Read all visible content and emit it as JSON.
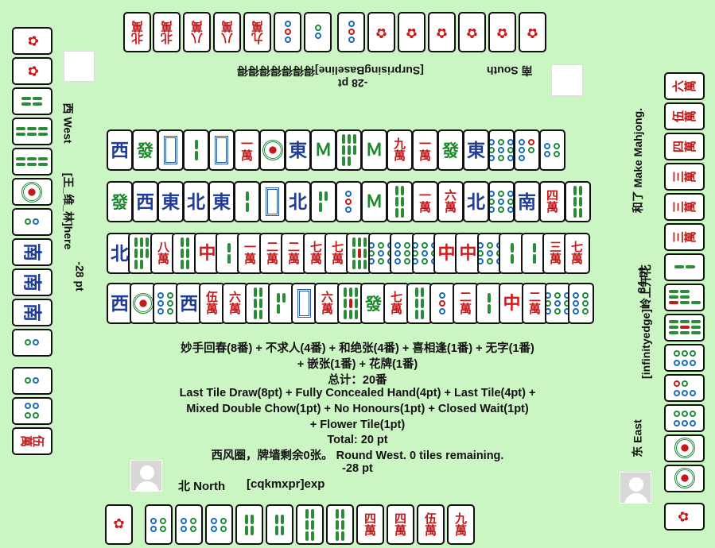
{
  "players": {
    "north": {
      "label": "北 North",
      "name": "[cqkmxpr]exp",
      "score": "-28 pt"
    },
    "east": {
      "label": "东 East",
      "name": "[infinityedge]岭上开花",
      "score": "84 pt",
      "action": "和了 Make Mahjong."
    },
    "south": {
      "label": "南 South",
      "name": "[SurprisingBaseline]得得得得得得得",
      "score": "-28 pt"
    },
    "west": {
      "label": "西 West",
      "name": "[王_维_林]here",
      "score": "-28 pt"
    }
  },
  "result": {
    "fan_cn_line1": "妙手回春(8番) + 不求人(4番) + 和绝张(4番) + 喜相逢(1番) + 无字(1番)",
    "fan_cn_line2": "+ 嵌张(1番) + 花牌(1番)",
    "total_cn": "总计：20番",
    "fan_en_line1": "Last Tile Draw(8pt) + Fully Concealed Hand(4pt) + Last Tile(4pt) +",
    "fan_en_line2": "Mixed Double Chow(1pt) + No Honours(1pt) + Closed Wait(1pt)",
    "fan_en_line3": "+ Flower Tile(1pt)",
    "total_en": "Total: 20 pt",
    "round_info": "西风圈，牌墙剩余0张。 Round West. 0 tiles remaining."
  },
  "tiles": {
    "south_hand": [
      "北萬",
      "北萬",
      "八萬",
      "八萬",
      "九萬",
      "3p",
      "2p",
      "3p",
      "F2s",
      "F2s",
      "F2s",
      "F2s",
      "F冬",
      "F春"
    ],
    "west_hand": [
      "F夏",
      "F竹",
      "4s",
      "6s",
      "6s",
      "1p",
      "2p",
      "南",
      "南",
      "南",
      "2p",
      "2p",
      "4p",
      "伍萬"
    ],
    "north_hand": [
      "F梅",
      "4p",
      "4p",
      "4p",
      "4s",
      "4s",
      "6s",
      "6s",
      "四萬",
      "四萬",
      "伍萬",
      "九萬"
    ],
    "east_hand": [
      "六萬",
      "伍萬",
      "四萬",
      "三萬",
      "三萬",
      "三萬",
      "2s",
      "7s",
      "9s",
      "6p",
      "5p",
      "6p",
      "1p",
      "1p",
      "F菊"
    ],
    "discards_row1": [
      "西",
      "發",
      "白",
      "2s",
      "白",
      "一萬",
      "1p",
      "東",
      "M",
      "8s",
      "M",
      "九萬",
      "一萬",
      "發",
      "東",
      "9p",
      "5p",
      "4p"
    ],
    "discards_row2": [
      "發",
      "西",
      "東",
      "北",
      "東",
      "2s",
      "白",
      "北",
      "3s",
      "3p",
      "M",
      "6s",
      "一萬",
      "六萬",
      "北",
      "9p",
      "南",
      "四萬",
      "6s"
    ],
    "discards_row3": [
      "北",
      "8s",
      "八萬",
      "6s",
      "中",
      "2s",
      "一萬",
      "二萬",
      "二萬",
      "七萬",
      "七萬",
      "9s",
      "9p",
      "6p",
      "9p",
      "中",
      "中",
      "9p",
      "2s",
      "2s",
      "三萬",
      "七萬"
    ],
    "discards_row4": [
      "西",
      "1p",
      "6p",
      "西",
      "伍萬",
      "六萬",
      "6s",
      "3s",
      "白",
      "六萬",
      "9s",
      "發",
      "七萬",
      "6s",
      "3p",
      "二萬",
      "2s",
      "中",
      "二萬",
      "9p",
      "6p"
    ]
  },
  "colors": {
    "background": "#ccf5c4",
    "tile_face": "#ffffff",
    "tile_border": "#111111",
    "character_red": "#c41a1a",
    "bamboo_green": "#2b8c36",
    "dots_blue": "#1a6bbd"
  }
}
